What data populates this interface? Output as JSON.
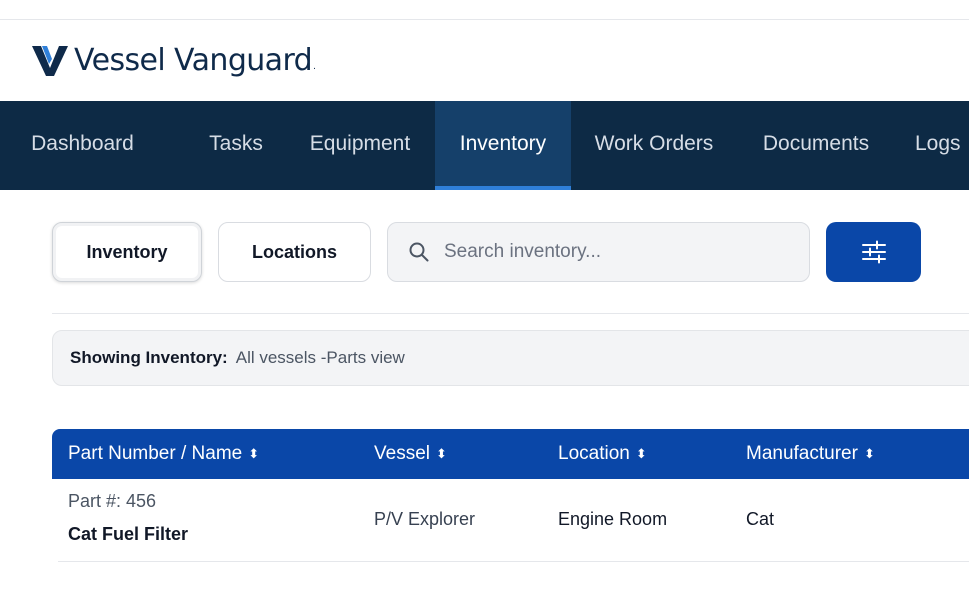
{
  "brand": {
    "name": "Vessel Vanguard",
    "trademark": ".",
    "color": "#0f2a4a"
  },
  "nav": {
    "items": [
      {
        "label": "Dashboard"
      },
      {
        "label": "Tasks"
      },
      {
        "label": "Equipment"
      },
      {
        "label": "Inventory",
        "active": true
      },
      {
        "label": "Work Orders"
      },
      {
        "label": "Documents"
      },
      {
        "label": "Logs"
      }
    ],
    "background": "#0d2a45",
    "active_background": "#15406a"
  },
  "toolbar": {
    "view_toggle": [
      {
        "label": "Inventory",
        "selected": true
      },
      {
        "label": "Locations",
        "selected": false
      }
    ],
    "search": {
      "value": "",
      "placeholder": "Search inventory...",
      "icon": "search-icon"
    },
    "filter_button": {
      "icon": "sliders-icon",
      "color": "#0a47a8"
    }
  },
  "banner": {
    "label": "Showing Inventory:",
    "value": "All vessels -Parts view"
  },
  "table": {
    "header_color": "#0a47a8",
    "columns": [
      {
        "label": "Part Number / Name",
        "sort_icon": "sort-icon"
      },
      {
        "label": "Vessel",
        "sort_icon": "sort-icon"
      },
      {
        "label": "Location",
        "sort_icon": "sort-icon"
      },
      {
        "label": "Manufacturer",
        "sort_icon": "sort-icon"
      }
    ],
    "sort_glyph": "⬍",
    "rows": [
      {
        "part_number": "Part #: 456",
        "name": "Cat Fuel Filter",
        "vessel": "P/V Explorer",
        "location": "Engine Room",
        "manufacturer": "Cat"
      }
    ]
  }
}
